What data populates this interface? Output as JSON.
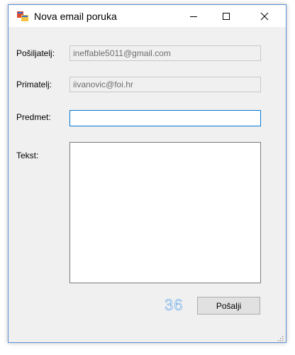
{
  "window": {
    "title": "Nova email poruka"
  },
  "form": {
    "sender_label": "Pošiljatelj:",
    "sender_value": "ineffable5011@gmail.com",
    "recipient_label": "Primatelj:",
    "recipient_value": "iivanovic@foi.hr",
    "subject_label": "Predmet:",
    "subject_value": "",
    "body_label": "Tekst:",
    "body_value": "",
    "char_counter": "36",
    "send_label": "Pošalji"
  },
  "icons": {
    "app": "app-window-icon",
    "minimize": "minimize-icon",
    "maximize": "maximize-icon",
    "close": "close-icon",
    "grip": "resize-grip-icon"
  },
  "colors": {
    "accent": "#0078d7",
    "counter": "#3c8cd8",
    "window_border": "#5b8fd6"
  }
}
